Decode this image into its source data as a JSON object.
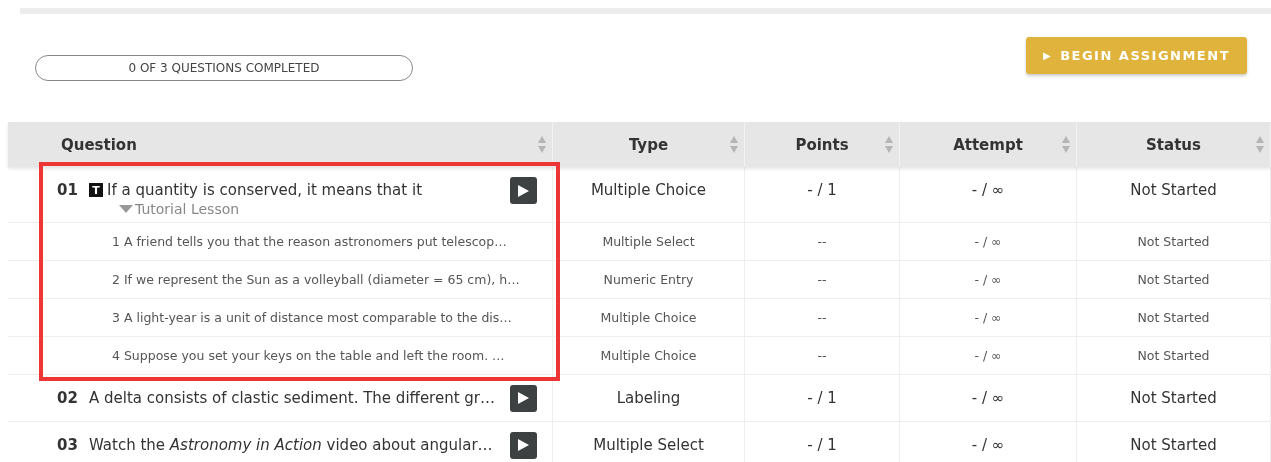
{
  "progress": {
    "label": "0 OF 3 QUESTIONS COMPLETED",
    "level": 0
  },
  "begin_button": {
    "icon": "▶",
    "label": "BEGIN ASSIGNMENT"
  },
  "table": {
    "columns": [
      "Question",
      "Type",
      "Points",
      "Attempt",
      "Status"
    ],
    "rows": [
      {
        "number": "01",
        "tutor_badge": "T",
        "text": "If a quantity is conserved, it means that it",
        "type": "Multiple Choice",
        "points": "- / 1",
        "attempt": "- / ∞",
        "status": "Not Started",
        "highlighted": true,
        "lesson": {
          "label": "Tutorial Lesson",
          "expanded": true,
          "children": [
            {
              "text": "1 A friend tells you that the reason astronomers put telescop…",
              "type": "Multiple Select",
              "points": "--",
              "attempt": "- / ∞",
              "status": "Not Started"
            },
            {
              "text": "2 If we represent the Sun as a volleyball (diameter = 65 cm), h…",
              "type": "Numeric Entry",
              "points": "--",
              "attempt": "- / ∞",
              "status": "Not Started"
            },
            {
              "text": "3 A light-year is a unit of distance most comparable to the dis…",
              "type": "Multiple Choice",
              "points": "--",
              "attempt": "- / ∞",
              "status": "Not Started"
            },
            {
              "text": "4 Suppose you set your keys on the table and left the room. …",
              "type": "Multiple Choice",
              "points": "--",
              "attempt": "- / ∞",
              "status": "Not Started"
            }
          ]
        }
      },
      {
        "number": "02",
        "text": "A delta consists of clastic sediment. The different gr…",
        "type": "Labeling",
        "points": "- / 1",
        "attempt": "- / ∞",
        "status": "Not Started",
        "highlighted": false
      },
      {
        "number": "03",
        "text": "Watch the *Astronomy in Action* video about angular…",
        "type": "Multiple Select",
        "points": "- / 1",
        "attempt": "- / ∞",
        "status": "Not Started",
        "highlighted": false
      }
    ]
  }
}
